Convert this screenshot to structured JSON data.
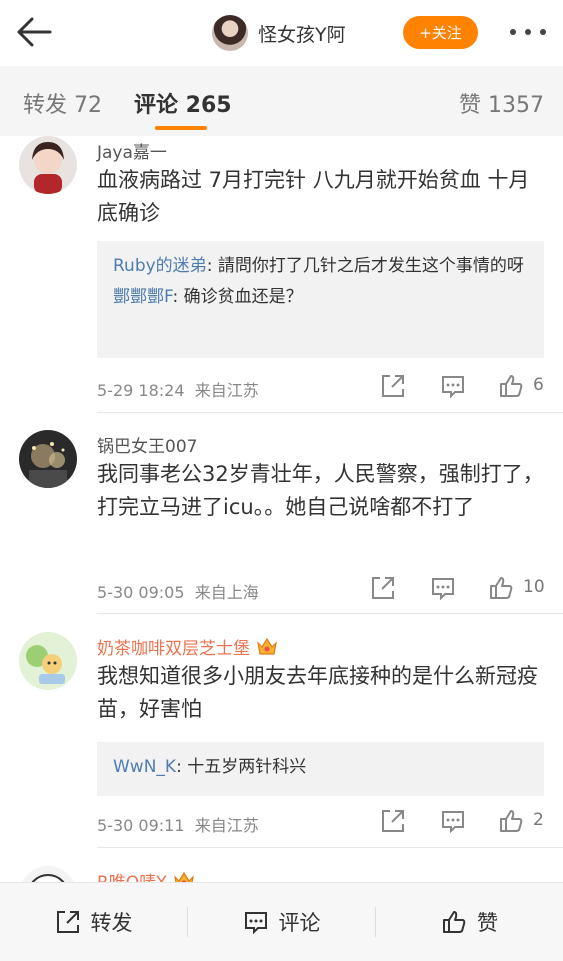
{
  "header": {
    "title": "怪女孩Y阿",
    "follow_label": "+关注",
    "follow_color": "#ff8200",
    "back_icon": "back-arrow-icon",
    "more_icon": "more-dots-icon"
  },
  "tabs": [
    {
      "label": "转发 72"
    },
    {
      "label": "评论 265",
      "active": true
    },
    {
      "label": "赞 1357"
    }
  ],
  "comments": [
    {
      "name": "Jaya嘉一",
      "text": "血液病路过 7月打完针 八九月就开始贫血 十月底确诊",
      "replies": [
        {
          "name": "Ruby的迷弟",
          "text": ": 請問你打了几针之后才发生这个事情的呀"
        },
        {
          "name": "酆酆酆F",
          "text": ": 确诊贫血还是？"
        }
      ],
      "time": "5-29 18:24",
      "source": "来自江苏",
      "likes": "6"
    },
    {
      "name": "锅巴女王007",
      "text": "我同事老公32岁青壮年，人民警察，强制打了，打完立马进了icu。。她自己说啥都不打了",
      "replies": [],
      "time": "5-30 09:05",
      "source": "来自上海",
      "likes": "10"
    },
    {
      "name": "奶茶咖啡双层芝士堡",
      "vip": true,
      "text": "我想知道很多小朋友去年底接种的是什么新冠疫苗，好害怕",
      "replies": [
        {
          "name": "WwN_K",
          "text": ": 十五岁两针科兴"
        }
      ],
      "time": "5-30 09:11",
      "source": "来自江苏",
      "likes": "2"
    },
    {
      "name": "R唯Q唛Y",
      "vip": true
    }
  ],
  "bottom_bar": {
    "repost": "转发",
    "comment": "评论",
    "like": "赞"
  },
  "colors": {
    "accent": "#ff8200",
    "link": "#507daf",
    "vip_name": "#eb7350"
  }
}
